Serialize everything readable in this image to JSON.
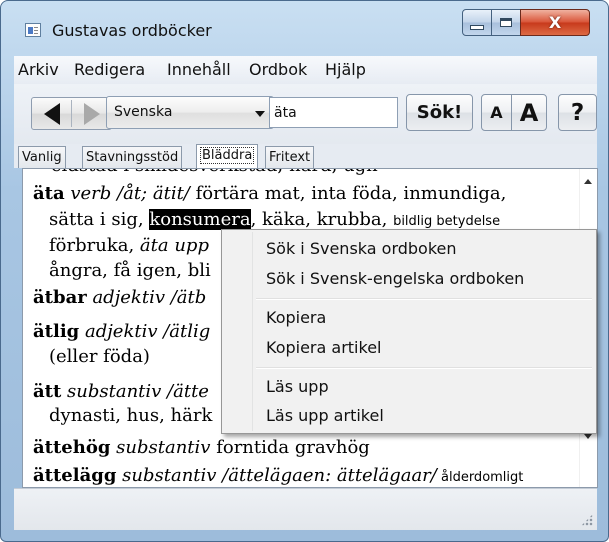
{
  "window": {
    "title": "Gustavas ordböcker",
    "close_glyph": "X"
  },
  "menu": [
    "Arkiv",
    "Redigera",
    "Innehåll",
    "Ordbok",
    "Hjälp"
  ],
  "toolbar": {
    "dictionary_selected": "Svenska",
    "search_value": "äta",
    "search_button": "Sök!",
    "font_smaller": "A",
    "font_larger": "A",
    "help": "?"
  },
  "tabs": [
    "Vanlig",
    "Stavningsstöd",
    "Bläddra",
    "Fritext"
  ],
  "active_tab": "Bläddra",
  "article_text": {
    "cut_line": "eldstad i smidesverkstad; härd, ugn",
    "l1_word": "äta",
    "l1_rest1": " verb /åt; ätit/",
    "l1_rest2": " förtära mat, inta föda, inmundiga,",
    "l2_a": "sätta i sig, ",
    "l2_hl": "konsumera",
    "l2_b": ", käka, krubba, ",
    "l2_small": "bildlig betydelse",
    "l3_a": "förbruka, ",
    "l3_b": "äta upp",
    "l4_a": "ångra, få igen, bli",
    "l5_word": "ätbar",
    "l5_rest": " adjektiv /ätb",
    "l6_word": "ätlig",
    "l6_rest": " adjektiv /ätlig",
    "l7": "(eller föda)",
    "l8_word": "ätt",
    "l8_rest": " substantiv /ätte",
    "l9": "dynasti, hus, härk",
    "l10_word": "ättehög",
    "l10_rest": " substantiv",
    "l10_def": " forntida gravhög",
    "l11_word": "ättelägg",
    "l11_rest": " substantiv /ättelägaen: ättelägaar/",
    "l11_small": " ålderdomligt"
  },
  "context_menu": {
    "groups": [
      [
        "Sök i Svenska ordboken",
        "Sök i Svensk-engelska ordboken"
      ],
      [
        "Kopiera",
        "Kopiera artikel"
      ],
      [
        "Läs upp",
        "Läs upp artikel"
      ]
    ]
  },
  "colors": {
    "title_bar": "#c9dff2",
    "highlight_bg": "#000000",
    "close_button": "#c83a1c"
  },
  "icons": [
    "app-icon",
    "back-arrow-icon",
    "forward-arrow-icon",
    "dropdown-arrow-icon",
    "scroll-up-icon",
    "scroll-down-icon",
    "resize-grip-icon"
  ]
}
